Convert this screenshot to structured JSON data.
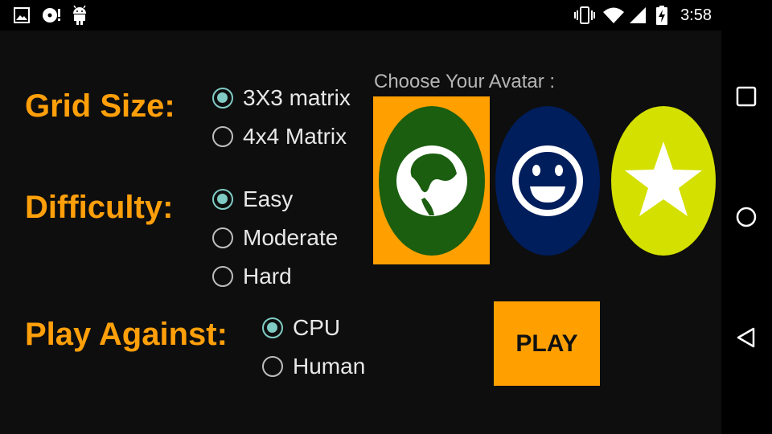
{
  "status_bar": {
    "time": "3:58",
    "left_icons": [
      "image-icon",
      "disc-alert-icon",
      "android-icon"
    ],
    "right_icons": [
      "vibrate-icon",
      "wifi-icon",
      "signal-icon",
      "battery-charging-icon"
    ]
  },
  "grid_size": {
    "label": "Grid Size:",
    "options": [
      "3X3 matrix",
      "4x4 Matrix"
    ],
    "selected": "3X3 matrix"
  },
  "difficulty": {
    "label": "Difficulty:",
    "options": [
      "Easy",
      "Moderate",
      "Hard"
    ],
    "selected": "Easy"
  },
  "play_against": {
    "label": "Play Against:",
    "options": [
      "CPU",
      "Human"
    ],
    "selected": "CPU"
  },
  "avatar": {
    "title": "Choose Your Avatar :",
    "options": [
      {
        "name": "globe-avatar-icon",
        "color": "#1b5e10"
      },
      {
        "name": "smiley-avatar-icon",
        "color": "#001e5c"
      },
      {
        "name": "star-avatar-icon",
        "color": "#d4e000"
      }
    ],
    "selected": "globe-avatar-icon",
    "selected_bg": "#ffa000"
  },
  "play_button": {
    "label": "PLAY"
  },
  "colors": {
    "accent": "#ff9f0a",
    "radio_checked": "#80cbc4"
  },
  "nav_bar": {
    "buttons": [
      "recents-square-icon",
      "home-circle-icon",
      "back-triangle-icon"
    ]
  }
}
